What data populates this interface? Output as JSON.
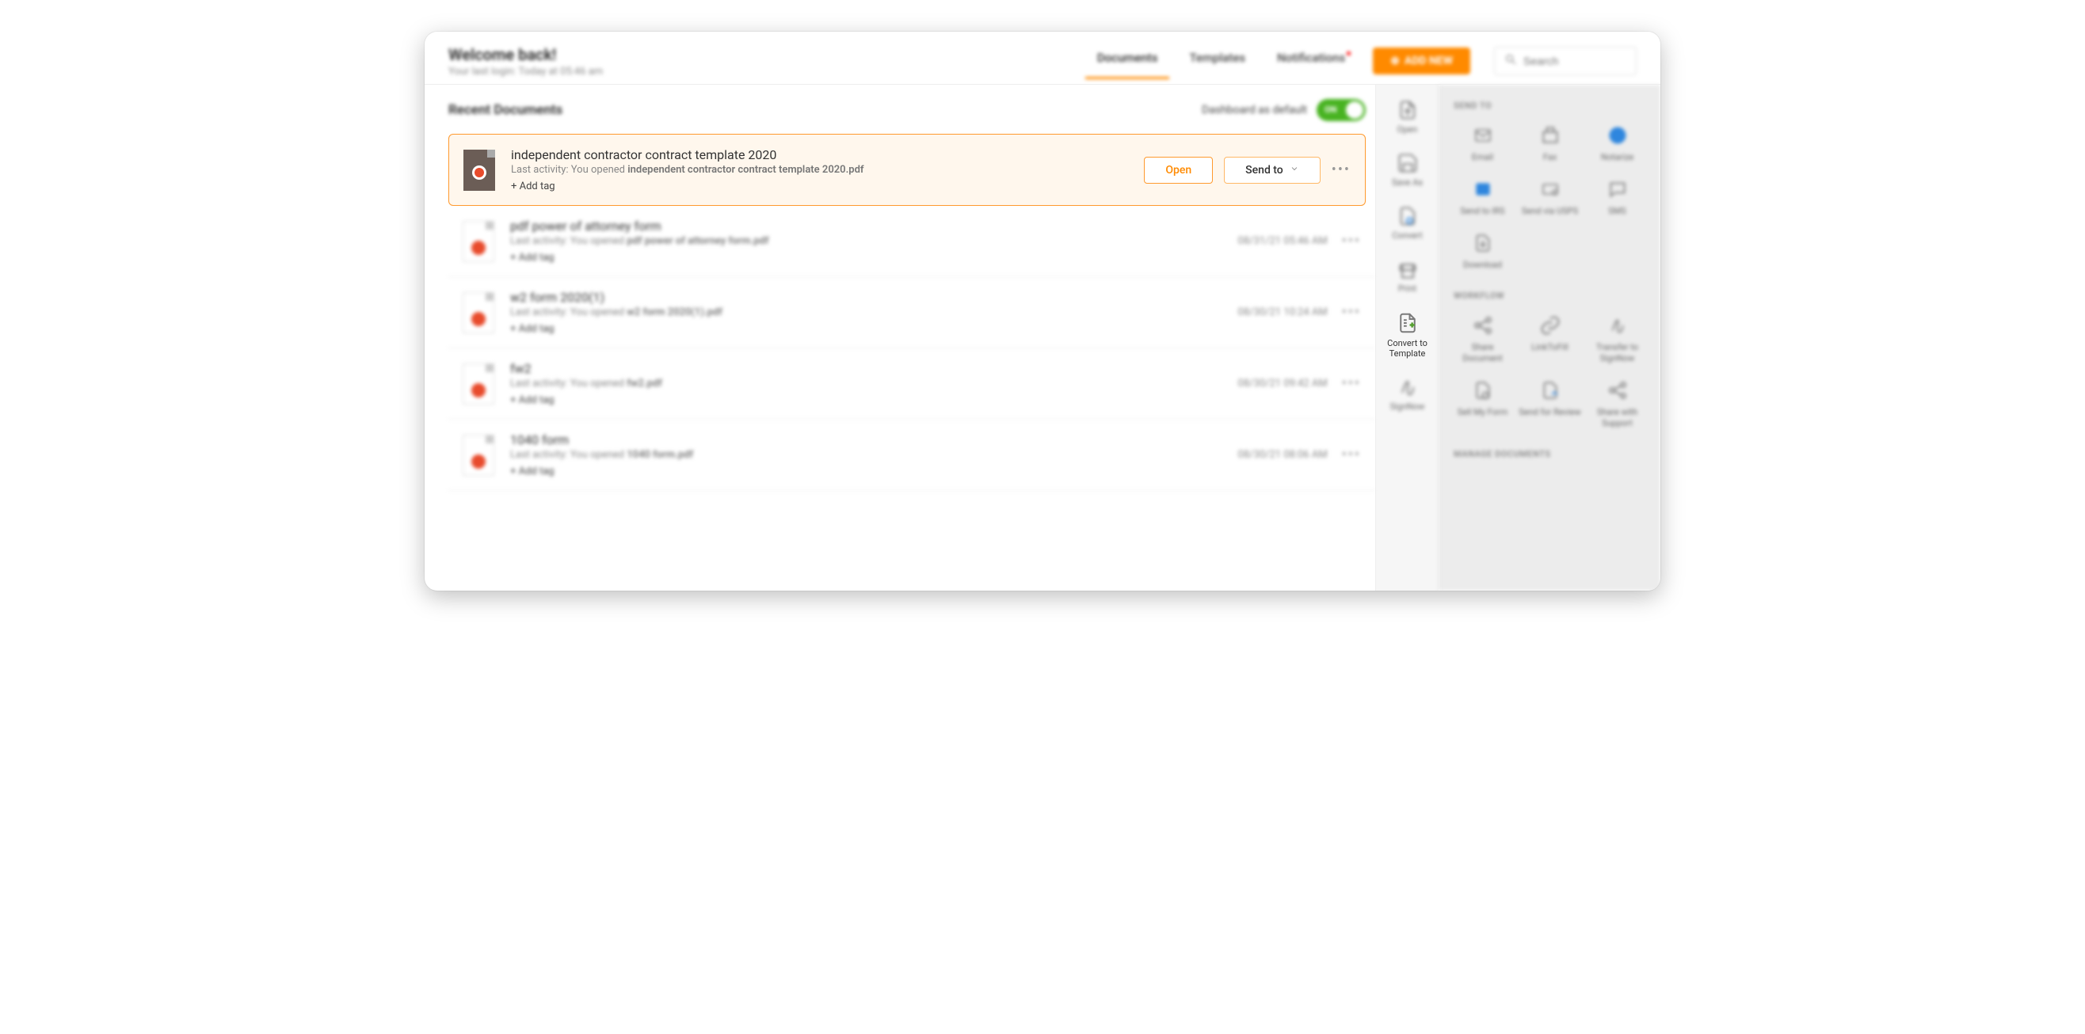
{
  "header": {
    "welcome": "Welcome back!",
    "last_login": "Your last login: Today at 05:46 am",
    "tabs": {
      "documents": "Documents",
      "templates": "Templates",
      "notifications": "Notifications"
    },
    "add_button": "ADD NEW",
    "search_placeholder": "Search"
  },
  "main": {
    "section_title": "Recent Documents",
    "default_toggle_label": "Dashboard as default",
    "toggle_on": "ON",
    "open_button": "Open",
    "sendto_button": "Send to",
    "add_tag": "Add tag"
  },
  "docs": [
    {
      "title": "independent contractor contract template 2020",
      "activity_prefix": "Last activity: You opened ",
      "activity_file": "independent contractor contract template 2020.pdf",
      "date": "",
      "highlighted": true
    },
    {
      "title": "pdf power of attorney form",
      "activity_prefix": "Last activity: You opened ",
      "activity_file": "pdf power of attorney form.pdf",
      "date": "08/31/21 05:46 AM",
      "highlighted": false
    },
    {
      "title": "w2 form 2020(1)",
      "activity_prefix": "Last activity: You opened ",
      "activity_file": "w2 form 2020(1).pdf",
      "date": "08/30/21 10:24 AM",
      "highlighted": false
    },
    {
      "title": "fw2",
      "activity_prefix": "Last activity: You opened ",
      "activity_file": "fw2.pdf",
      "date": "08/30/21 09:42 AM",
      "highlighted": false
    },
    {
      "title": "1040 form",
      "activity_prefix": "Last activity: You opened ",
      "activity_file": "1040 form.pdf",
      "date": "08/30/21 08:06 AM",
      "highlighted": false
    }
  ],
  "mini_rail": {
    "open": "Open",
    "save_as": "Save As",
    "convert": "Convert",
    "print": "Print",
    "convert_template": "Convert to Template",
    "signnow": "SignNow"
  },
  "panel": {
    "send_to": "SEND TO",
    "workflow": "WORKFLOW",
    "manage": "MANAGE DOCUMENTS",
    "items": {
      "email": "Email",
      "fax": "Fax",
      "notarize": "Notarize",
      "irs": "Send to IRS",
      "usps": "Send via USPS",
      "sms": "SMS",
      "download": "Download",
      "share": "Share Document",
      "link": "LinkToFill",
      "transfer": "Transfer to SignNow",
      "sell": "Sell My Form",
      "review": "Send for Review",
      "support": "Share with Support"
    }
  }
}
